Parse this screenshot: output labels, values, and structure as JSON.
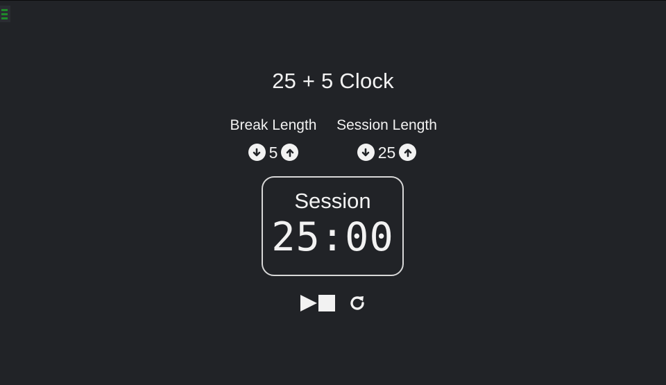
{
  "header": {
    "title": "25 + 5 Clock"
  },
  "break": {
    "label": "Break Length",
    "value": "5",
    "decrement_icon": "arrow-circle-down-icon",
    "increment_icon": "arrow-circle-up-icon"
  },
  "session": {
    "label": "Session Length",
    "value": "25",
    "decrement_icon": "arrow-circle-down-icon",
    "increment_icon": "arrow-circle-up-icon"
  },
  "timer": {
    "label": "Session",
    "time_left": "25:00"
  },
  "controls": {
    "start_stop_icons": [
      "play-icon",
      "stop-icon"
    ],
    "reset_icon": "refresh-icon"
  },
  "colors": {
    "background": "#212327",
    "foreground": "#f2f2f2",
    "menu_accent": "#1f8a2a"
  }
}
